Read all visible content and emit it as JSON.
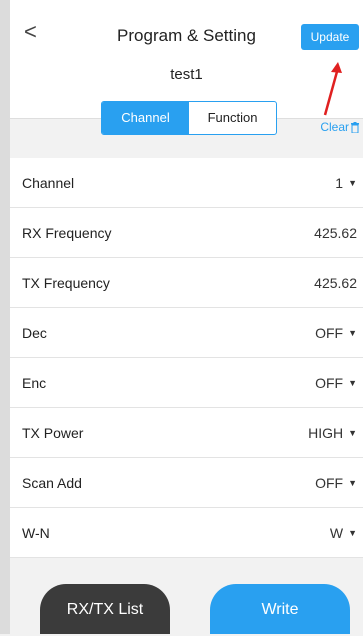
{
  "header": {
    "back_icon": "<",
    "title": "Program & Setting",
    "update_label": "Update",
    "device_name": "test1",
    "tabs": [
      {
        "label": "Channel",
        "active": true
      },
      {
        "label": "Function",
        "active": false
      }
    ],
    "clear_label": "Clear",
    "trash_icon": "trash-icon"
  },
  "rows": [
    {
      "label": "Channel",
      "value": "1",
      "dropdown": true
    },
    {
      "label": "RX Frequency",
      "value": "425.62",
      "dropdown": false
    },
    {
      "label": "TX Frequency",
      "value": "425.62",
      "dropdown": false
    },
    {
      "label": "Dec",
      "value": "OFF",
      "dropdown": true
    },
    {
      "label": "Enc",
      "value": "OFF",
      "dropdown": true
    },
    {
      "label": "TX Power",
      "value": "HIGH",
      "dropdown": true
    },
    {
      "label": "Scan Add",
      "value": "OFF",
      "dropdown": true
    },
    {
      "label": "W-N",
      "value": "W",
      "dropdown": true
    }
  ],
  "bottom": {
    "rxtx_label": "RX/TX List",
    "write_label": "Write"
  },
  "colors": {
    "accent": "#29a0f0",
    "dark_button": "#3b3b3b",
    "annotation_arrow": "#e02020"
  }
}
